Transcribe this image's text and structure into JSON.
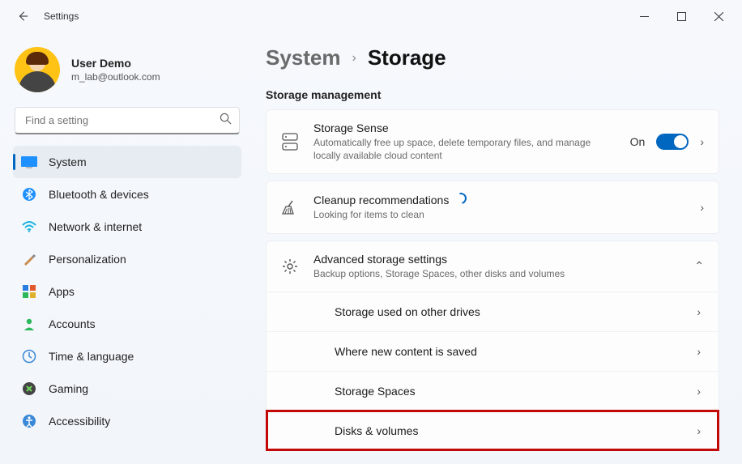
{
  "window": {
    "title": "Settings"
  },
  "user": {
    "name": "User Demo",
    "email": "m_lab@outlook.com"
  },
  "search": {
    "placeholder": "Find a setting"
  },
  "nav": {
    "items": [
      {
        "label": "System"
      },
      {
        "label": "Bluetooth & devices"
      },
      {
        "label": "Network & internet"
      },
      {
        "label": "Personalization"
      },
      {
        "label": "Apps"
      },
      {
        "label": "Accounts"
      },
      {
        "label": "Time & language"
      },
      {
        "label": "Gaming"
      },
      {
        "label": "Accessibility"
      }
    ]
  },
  "breadcrumb": {
    "parent": "System",
    "current": "Storage"
  },
  "section": {
    "title": "Storage management"
  },
  "storageSense": {
    "title": "Storage Sense",
    "sub": "Automatically free up space, delete temporary files, and manage locally available cloud content",
    "state": "On"
  },
  "cleanup": {
    "title": "Cleanup recommendations",
    "sub": "Looking for items to clean"
  },
  "advanced": {
    "title": "Advanced storage settings",
    "sub": "Backup options, Storage Spaces, other disks and volumes",
    "items": [
      {
        "label": "Storage used on other drives"
      },
      {
        "label": "Where new content is saved"
      },
      {
        "label": "Storage Spaces"
      },
      {
        "label": "Disks & volumes"
      }
    ]
  }
}
